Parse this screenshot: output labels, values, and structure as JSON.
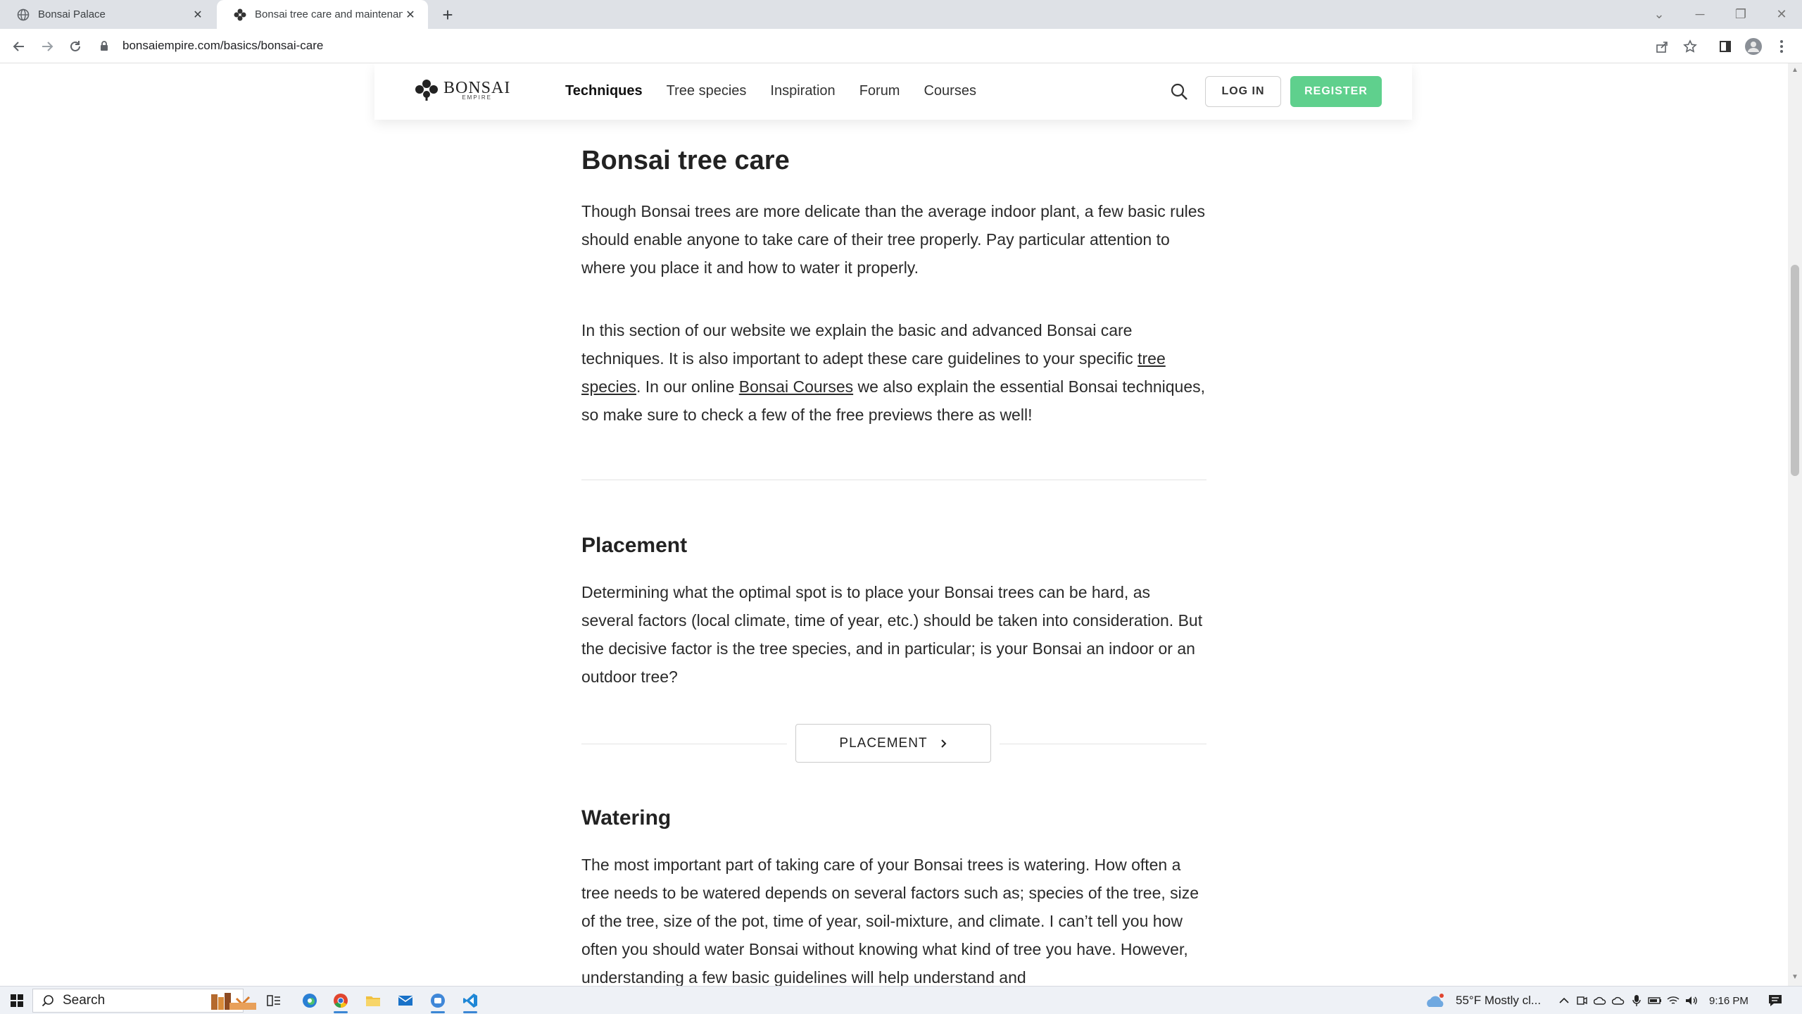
{
  "browser": {
    "tabs": [
      {
        "title": "Bonsai Palace",
        "active": false
      },
      {
        "title": "Bonsai tree care and maintenance",
        "active": true
      }
    ],
    "url": "bonsaiempire.com/basics/bonsai-care"
  },
  "site": {
    "logo_word": "BONSAI",
    "logo_sub": "EMPIRE",
    "menu": [
      "Techniques",
      "Tree species",
      "Inspiration",
      "Forum",
      "Courses"
    ],
    "login_label": "LOG IN",
    "register_label": "REGISTER",
    "accent_color": "#5fd08d"
  },
  "article": {
    "title": "Bonsai tree care",
    "intro": "Though Bonsai trees are more delicate than the average indoor plant, a few basic rules should enable anyone to take care of their tree properly. Pay particular attention to where you place it and how to water it properly.",
    "p2_part1": "In this section of our website we explain the basic and advanced Bonsai care techniques. It is also important to adept these care guidelines to your specific ",
    "p2_link1": "tree species",
    "p2_part2": ". In our online ",
    "p2_link2": "Bonsai Courses",
    "p2_part3": " we also explain the essential Bonsai techniques, so make sure to check a few of the free previews there as well!",
    "placement_heading": "Placement",
    "placement_text": "Determining what the optimal spot is to place your Bonsai trees can be hard, as several factors (local climate, time of year, etc.) should be taken into consideration. But the decisive factor is the tree species, and in particular; is your Bonsai an indoor or an outdoor tree?",
    "placement_button": "PLACEMENT",
    "watering_heading": "Watering",
    "watering_text": "The most important part of taking care of your Bonsai trees is watering. How often a tree needs to be watered depends on several factors such as; species of the tree, size of the tree, size of the pot, time of year, soil-mixture, and climate. I can’t tell you how often you should water Bonsai without knowing what kind of tree you have. However, understanding a few basic guidelines will help understand and"
  },
  "taskbar": {
    "search_label": "Search",
    "weather": "55°F  Mostly cl...",
    "time": "9:16 PM"
  }
}
